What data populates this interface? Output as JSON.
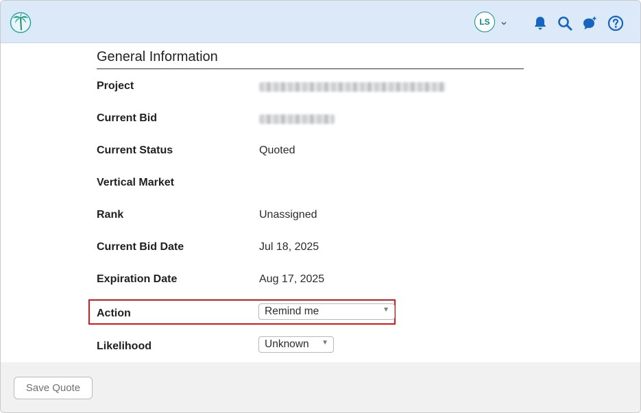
{
  "header": {
    "user_initials": "LS",
    "icons": [
      "palm-tree-logo",
      "bell-icon",
      "search-icon",
      "sparkle-chat-icon",
      "help-icon",
      "chevron-down-icon"
    ]
  },
  "section": {
    "title": "General Information"
  },
  "fields": {
    "project": {
      "label": "Project"
    },
    "current_bid": {
      "label": "Current Bid"
    },
    "current_status": {
      "label": "Current Status",
      "value": "Quoted"
    },
    "vertical_market": {
      "label": "Vertical Market",
      "value": ""
    },
    "rank": {
      "label": "Rank",
      "value": "Unassigned"
    },
    "current_bid_date": {
      "label": "Current Bid Date",
      "value": "Jul 18, 2025"
    },
    "expiration_date": {
      "label": "Expiration Date",
      "value": "Aug 17, 2025"
    },
    "action": {
      "label": "Action",
      "selected": "Remind me"
    },
    "likelihood": {
      "label": "Likelihood",
      "selected": "Unknown"
    }
  },
  "footer": {
    "save_label": "Save Quote"
  },
  "colors": {
    "header_bg": "#dbe9f8",
    "accent": "#0f8a86",
    "icon_blue": "#1565c0",
    "highlight": "#e01616"
  }
}
